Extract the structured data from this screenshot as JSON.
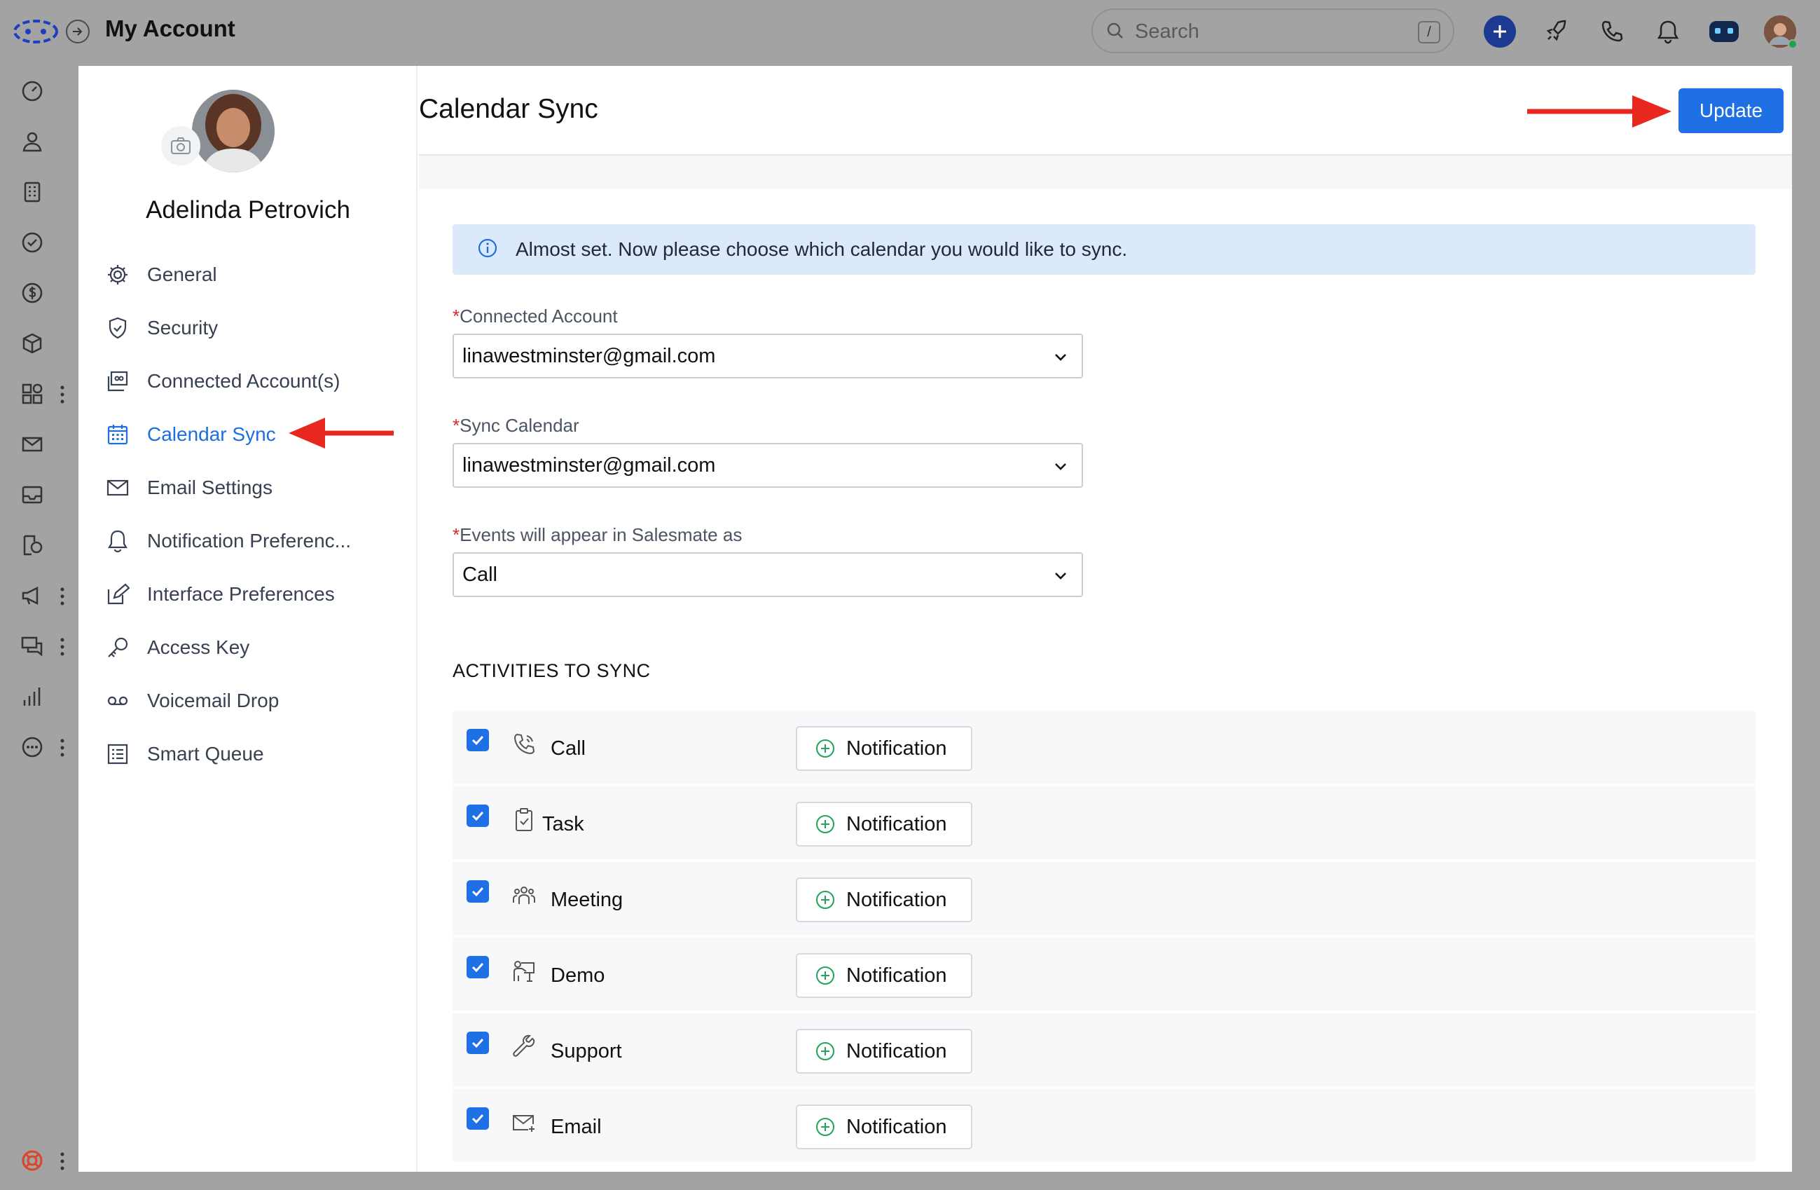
{
  "header": {
    "title": "My Account",
    "search_placeholder": "Search",
    "search_shortcut": "/"
  },
  "icons": {
    "logo": "salesmate-logo-icon",
    "back": "arrow-right-circle-icon",
    "add": "plus-circle-icon",
    "rocket": "rocket-icon",
    "phone": "phone-icon",
    "bell": "bell-icon",
    "assistant": "assistant-bot-icon",
    "rail": [
      "speedometer-icon",
      "user-icon",
      "building-icon",
      "check-circle-icon",
      "dollar-icon",
      "box-icon",
      "apps-icon",
      "mail-icon",
      "inbox-icon",
      "pipeline-icon",
      "megaphone-icon",
      "chat-icon",
      "bar-chart-icon",
      "more-circle-icon",
      "lifebuoy-icon"
    ]
  },
  "profile": {
    "name": "Adelinda Petrovich"
  },
  "nav": {
    "items": [
      {
        "label": "General",
        "icon": "gear-icon"
      },
      {
        "label": "Security",
        "icon": "shield-icon"
      },
      {
        "label": "Connected Account(s)",
        "icon": "linked-accounts-icon"
      },
      {
        "label": "Calendar Sync",
        "icon": "calendar-icon",
        "active": true
      },
      {
        "label": "Email Settings",
        "icon": "envelope-icon"
      },
      {
        "label": "Notification Preferenc...",
        "icon": "bell-icon"
      },
      {
        "label": "Interface Preferences",
        "icon": "edit-icon"
      },
      {
        "label": "Access Key",
        "icon": "key-icon"
      },
      {
        "label": "Voicemail Drop",
        "icon": "voicemail-icon"
      },
      {
        "label": "Smart Queue",
        "icon": "list-icon"
      }
    ]
  },
  "main": {
    "title": "Calendar Sync",
    "update_label": "Update",
    "info_text": "Almost set. Now please choose which calendar you would like to sync.",
    "required_mark": "*",
    "fields": [
      {
        "label": "Connected Account",
        "value": "linawestminster@gmail.com"
      },
      {
        "label": "Sync Calendar",
        "value": "linawestminster@gmail.com"
      },
      {
        "label": "Events will appear in Salesmate as",
        "value": "Call"
      }
    ],
    "activities_title": "ACTIVITIES TO SYNC",
    "notification_label": "Notification",
    "activities": [
      {
        "name": "Call",
        "icon": "phone-outline-icon",
        "checked": true
      },
      {
        "name": "Task",
        "icon": "clipboard-check-icon",
        "checked": true
      },
      {
        "name": "Meeting",
        "icon": "people-group-icon",
        "checked": true
      },
      {
        "name": "Demo",
        "icon": "presentation-icon",
        "checked": true
      },
      {
        "name": "Support",
        "icon": "wrench-icon",
        "checked": true
      },
      {
        "name": "Email",
        "icon": "envelope-plus-icon",
        "checked": true
      }
    ]
  },
  "colors": {
    "accent": "#1f6fe5",
    "annotation_arrow": "#e8271f",
    "banner": "#dbe9fb"
  }
}
